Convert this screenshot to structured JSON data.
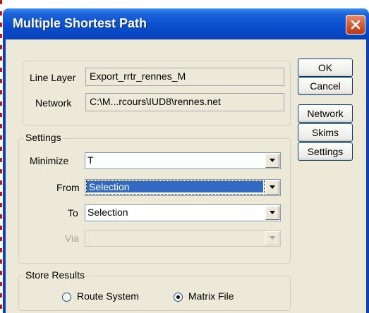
{
  "dialog": {
    "title": "Multiple Shortest Path"
  },
  "info": {
    "line_layer_label": "Line Layer",
    "line_layer_value": "Export_rrtr_rennes_M",
    "network_label": "Network",
    "network_value": "C:\\M...rcours\\IUD8\\rennes.net"
  },
  "buttons": {
    "ok": "OK",
    "cancel": "Cancel",
    "network": "Network",
    "skims": "Skims",
    "settings": "Settings"
  },
  "settings": {
    "group_label": "Settings",
    "minimize_label": "Minimize",
    "minimize_value": "T",
    "from_label": "From",
    "from_value": "Selection",
    "to_label": "To",
    "to_value": "Selection",
    "via_label": "Via",
    "via_value": ""
  },
  "store_results": {
    "group_label": "Store Results",
    "options": [
      {
        "label": "Route System",
        "selected": false
      },
      {
        "label": "Matrix File",
        "selected": true
      }
    ]
  }
}
